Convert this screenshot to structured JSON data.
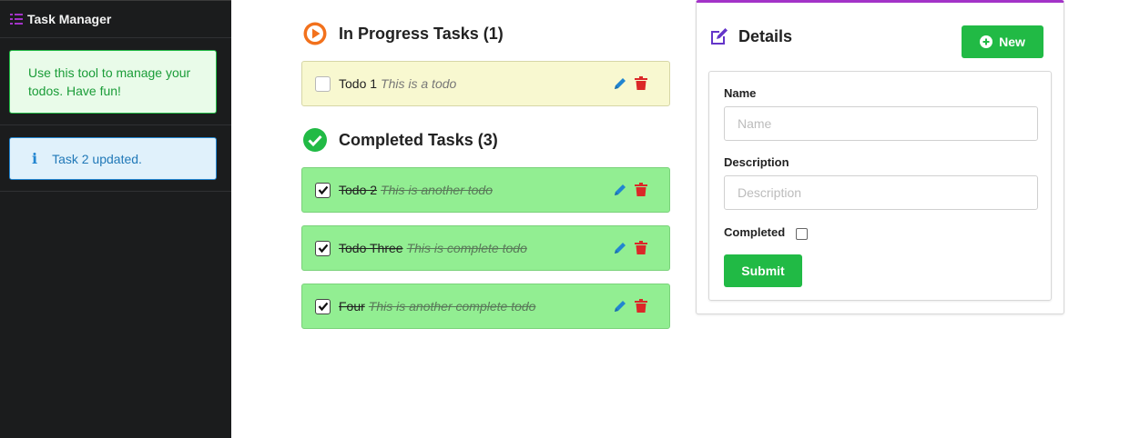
{
  "sidebar": {
    "title": "Task Manager",
    "icon": "task-list-icon",
    "welcome_message": "Use this tool to manage your todos. Have fun!",
    "notification": "Task 2 updated."
  },
  "in_progress": {
    "heading": "In Progress Tasks (1)",
    "icon": "play-circle-icon",
    "tasks": [
      {
        "name": "Todo 1",
        "description": "This is a todo",
        "completed": false
      }
    ]
  },
  "completed": {
    "heading": "Completed Tasks (3)",
    "icon": "check-circle-icon",
    "tasks": [
      {
        "name": "Todo 2",
        "description": "This is another todo",
        "completed": true
      },
      {
        "name": "Todo Three",
        "description": "This is complete todo",
        "completed": true
      },
      {
        "name": "Four",
        "description": "This is another complete todo",
        "completed": true
      }
    ]
  },
  "details": {
    "heading": "Details",
    "icon": "edit-icon",
    "new_button": "New",
    "form": {
      "name_label": "Name",
      "name_placeholder": "Name",
      "name_value": "",
      "description_label": "Description",
      "description_placeholder": "Description",
      "description_value": "",
      "completed_label": "Completed",
      "completed_checked": false,
      "submit_label": "Submit"
    }
  },
  "colors": {
    "sidebar_bg": "#1b1c1d",
    "accent_purple": "#a333c8",
    "success_green": "#21ba45",
    "info_blue": "#2185d0",
    "progress_orange": "#f2711c",
    "delete_red": "#db2828",
    "pending_task_bg": "#f8f8d0",
    "done_task_bg": "#92ee92"
  }
}
